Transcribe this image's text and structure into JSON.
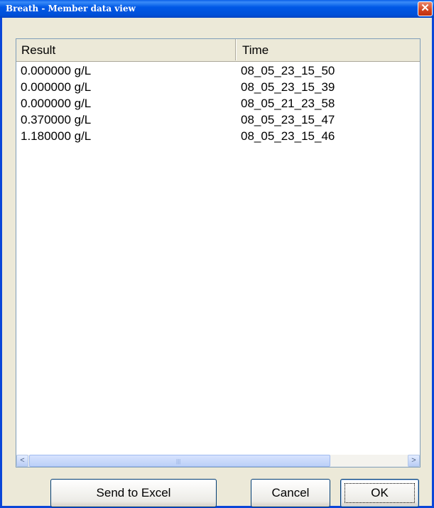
{
  "window": {
    "title": "Breath - Member data view",
    "close_glyph": "✕"
  },
  "list": {
    "columns": [
      "Result",
      "Time"
    ],
    "rows": [
      [
        "0.000000 g/L",
        "08_05_23_15_50"
      ],
      [
        "0.000000 g/L",
        "08_05_23_15_39"
      ],
      [
        "0.000000 g/L",
        "08_05_21_23_58"
      ],
      [
        "0.370000 g/L",
        "08_05_23_15_47"
      ],
      [
        "1.180000 g/L",
        "08_05_23_15_46"
      ]
    ]
  },
  "scrollbar": {
    "left_glyph": "<",
    "right_glyph": ">",
    "grip_glyph": "|||"
  },
  "buttons": {
    "send_to_excel": "Send to Excel",
    "cancel": "Cancel",
    "ok": "OK"
  },
  "colors": {
    "titlebar": "#0054e3",
    "close": "#d2431c",
    "frame": "#ece9d8"
  }
}
